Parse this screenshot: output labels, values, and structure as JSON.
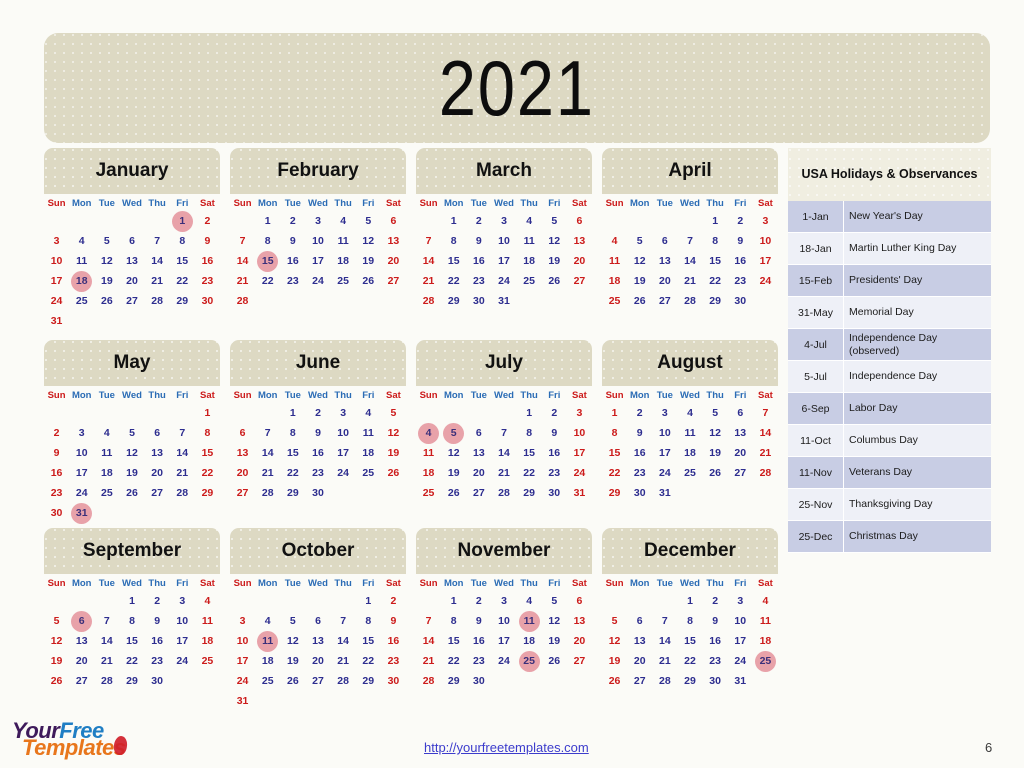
{
  "title": "2021",
  "weekday_headers": [
    "Sun",
    "Mon",
    "Tue",
    "Wed",
    "Thu",
    "Fri",
    "Sat"
  ],
  "months": [
    {
      "name": "January",
      "first_weekday": 5,
      "days": 31,
      "highlights": [
        1,
        18
      ]
    },
    {
      "name": "February",
      "first_weekday": 1,
      "days": 28,
      "highlights": [
        15
      ]
    },
    {
      "name": "March",
      "first_weekday": 1,
      "days": 31,
      "highlights": []
    },
    {
      "name": "April",
      "first_weekday": 4,
      "days": 30,
      "highlights": []
    },
    {
      "name": "May",
      "first_weekday": 6,
      "days": 31,
      "highlights": [
        31
      ]
    },
    {
      "name": "June",
      "first_weekday": 2,
      "days": 30,
      "highlights": []
    },
    {
      "name": "July",
      "first_weekday": 4,
      "days": 31,
      "highlights": [
        4,
        5
      ]
    },
    {
      "name": "August",
      "first_weekday": 0,
      "days": 31,
      "highlights": []
    },
    {
      "name": "September",
      "first_weekday": 3,
      "days": 30,
      "highlights": [
        6
      ]
    },
    {
      "name": "October",
      "first_weekday": 5,
      "days": 31,
      "highlights": [
        11
      ]
    },
    {
      "name": "November",
      "first_weekday": 1,
      "days": 30,
      "highlights": [
        11,
        25
      ]
    },
    {
      "name": "December",
      "first_weekday": 3,
      "days": 31,
      "highlights": [
        25
      ]
    }
  ],
  "holidays": {
    "heading": "USA Holidays & Observances",
    "rows": [
      {
        "date": "1-Jan",
        "name": "New Year's Day"
      },
      {
        "date": "18-Jan",
        "name": "Martin Luther King Day"
      },
      {
        "date": "15-Feb",
        "name": "Presidents' Day"
      },
      {
        "date": "31-May",
        "name": "Memorial Day"
      },
      {
        "date": "4-Jul",
        "name": "Independence Day (observed)"
      },
      {
        "date": "5-Jul",
        "name": "Independence Day"
      },
      {
        "date": "6-Sep",
        "name": "Labor Day"
      },
      {
        "date": "11-Oct",
        "name": "Columbus Day"
      },
      {
        "date": "11-Nov",
        "name": "Veterans Day"
      },
      {
        "date": "25-Nov",
        "name": "Thanksgiving Day"
      },
      {
        "date": "25-Dec",
        "name": "Christmas Day"
      }
    ]
  },
  "footer": {
    "logo_your": "Your",
    "logo_free": "Free",
    "logo_templates": "Templates",
    "url": "http://yourfreetemplates.com",
    "page_number": "6"
  },
  "colors": {
    "banner": "#ddd9c3",
    "page_background": "#fbfbf7",
    "weekend_text": "#cc1b1b",
    "weekday_text": "#2d2d8f",
    "weekday_header": "#2b6cb5",
    "highlight_circle": "#e8a2a9",
    "holiday_row_odd": "#c8cde4",
    "holiday_row_even": "#eef0f7",
    "link": "#3c3ccc"
  }
}
